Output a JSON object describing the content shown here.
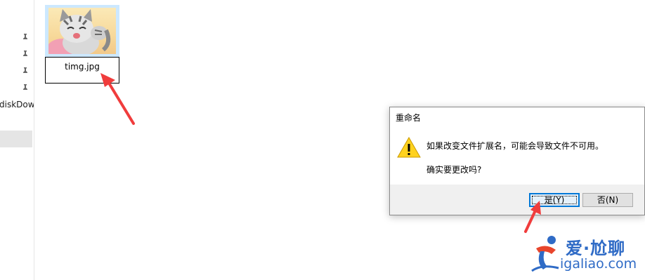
{
  "nav": {
    "item_label": "diskDow",
    "pins": [
      "pin-icon",
      "pin-icon",
      "pin-icon",
      "pin-icon"
    ]
  },
  "file": {
    "name": "timg.jpg",
    "thumbnail": "cat-cartoon-image"
  },
  "dialog": {
    "title": "重命名",
    "icon": "warning-icon",
    "message": "如果改变文件扩展名，可能会导致文件不可用。",
    "question": "确实要更改吗?",
    "yes_label": "是(Y)",
    "no_label": "否(N)"
  },
  "annotations": {
    "arrow_color": "#f03c3c"
  },
  "watermark": {
    "cn": "爱·尬聊",
    "en": "igaliao.com"
  },
  "colors": {
    "selection": "#cce8ff",
    "button_focus": "#0078d7",
    "watermark_blue": "#2f6bc6"
  }
}
